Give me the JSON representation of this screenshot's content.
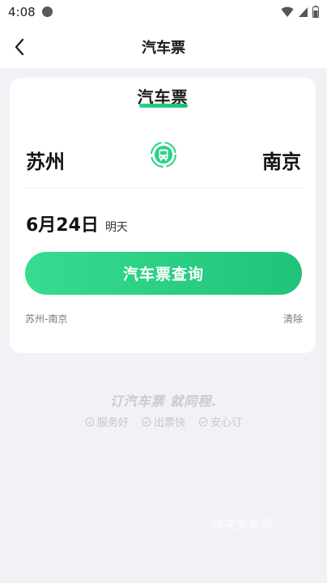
{
  "status_bar": {
    "time": "4:08",
    "icons": [
      "record-dot-icon",
      "wifi-icon",
      "signal-icon",
      "battery-icon"
    ]
  },
  "nav": {
    "title": "汽车票",
    "back_icon": "chevron-left-icon"
  },
  "card": {
    "tab_label": "汽车票",
    "from_city": "苏州",
    "to_city": "南京",
    "swap_icon": "bus-swap-icon",
    "date_main": "6月24日",
    "date_sub": "明天",
    "search_button": "汽车票查询",
    "history_item": "苏州-南京",
    "clear_label": "清除"
  },
  "slogan": "订汽车票 就同程.",
  "features": [
    {
      "label": "服务好",
      "icon": "check-circle-icon"
    },
    {
      "label": "出票快",
      "icon": "check-circle-icon"
    },
    {
      "label": "安心订",
      "icon": "check-circle-icon"
    }
  ],
  "watermark": "绿花安卓网",
  "colors": {
    "accent": "#2ad28a",
    "background": "#f1f2f6",
    "card": "#ffffff",
    "muted_text": "#7a7a7a"
  }
}
